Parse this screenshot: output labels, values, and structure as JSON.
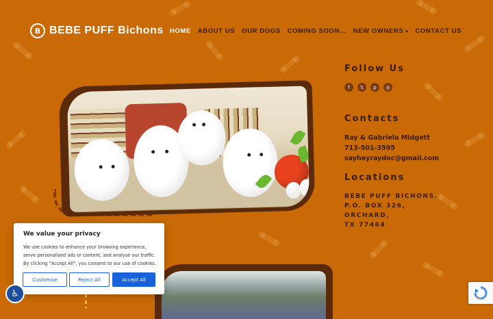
{
  "header": {
    "logo_mark": "B",
    "logo_text": "BEBE PUFF Bichons",
    "nav": [
      {
        "label": "HOME",
        "active": true
      },
      {
        "label": "ABOUT US"
      },
      {
        "label": "OUR DOGS"
      },
      {
        "label": "COMING SOON..."
      },
      {
        "label": "NEW OWNERS",
        "caret": "▾"
      },
      {
        "label": "CONTACT US"
      }
    ]
  },
  "follow": {
    "title": "Follow Us",
    "icons": [
      "facebook-icon",
      "x-icon",
      "pinterest-icon",
      "instagram-icon"
    ],
    "glyphs": [
      "f",
      "𝕏",
      "p",
      "◎"
    ]
  },
  "contacts": {
    "title": "Contacts",
    "name": "Ray & Gabriela Midgett",
    "phone": "713-501-3595",
    "email": "sayheyraydoc@gmail.com"
  },
  "locations": {
    "title": "Locations",
    "lines": [
      "BEBE PUFF BICHONS.",
      "P.O. BOX 326,",
      "ORCHARD,",
      "TX 77464"
    ]
  },
  "cookie": {
    "title": "We value your privacy",
    "body": "We use cookies to enhance your browsing experience, serve personalised ads or content, and analyse our traffic. By clicking \"Accept All\", you consent to our use of cookies.",
    "customise": "Customise",
    "reject": "Reject All",
    "accept": "Accept All"
  },
  "accessibility": {
    "glyph": "♿"
  },
  "colors": {
    "background": "#c96a07",
    "accent": "#1863dc",
    "text_dark": "#3b1d04"
  }
}
